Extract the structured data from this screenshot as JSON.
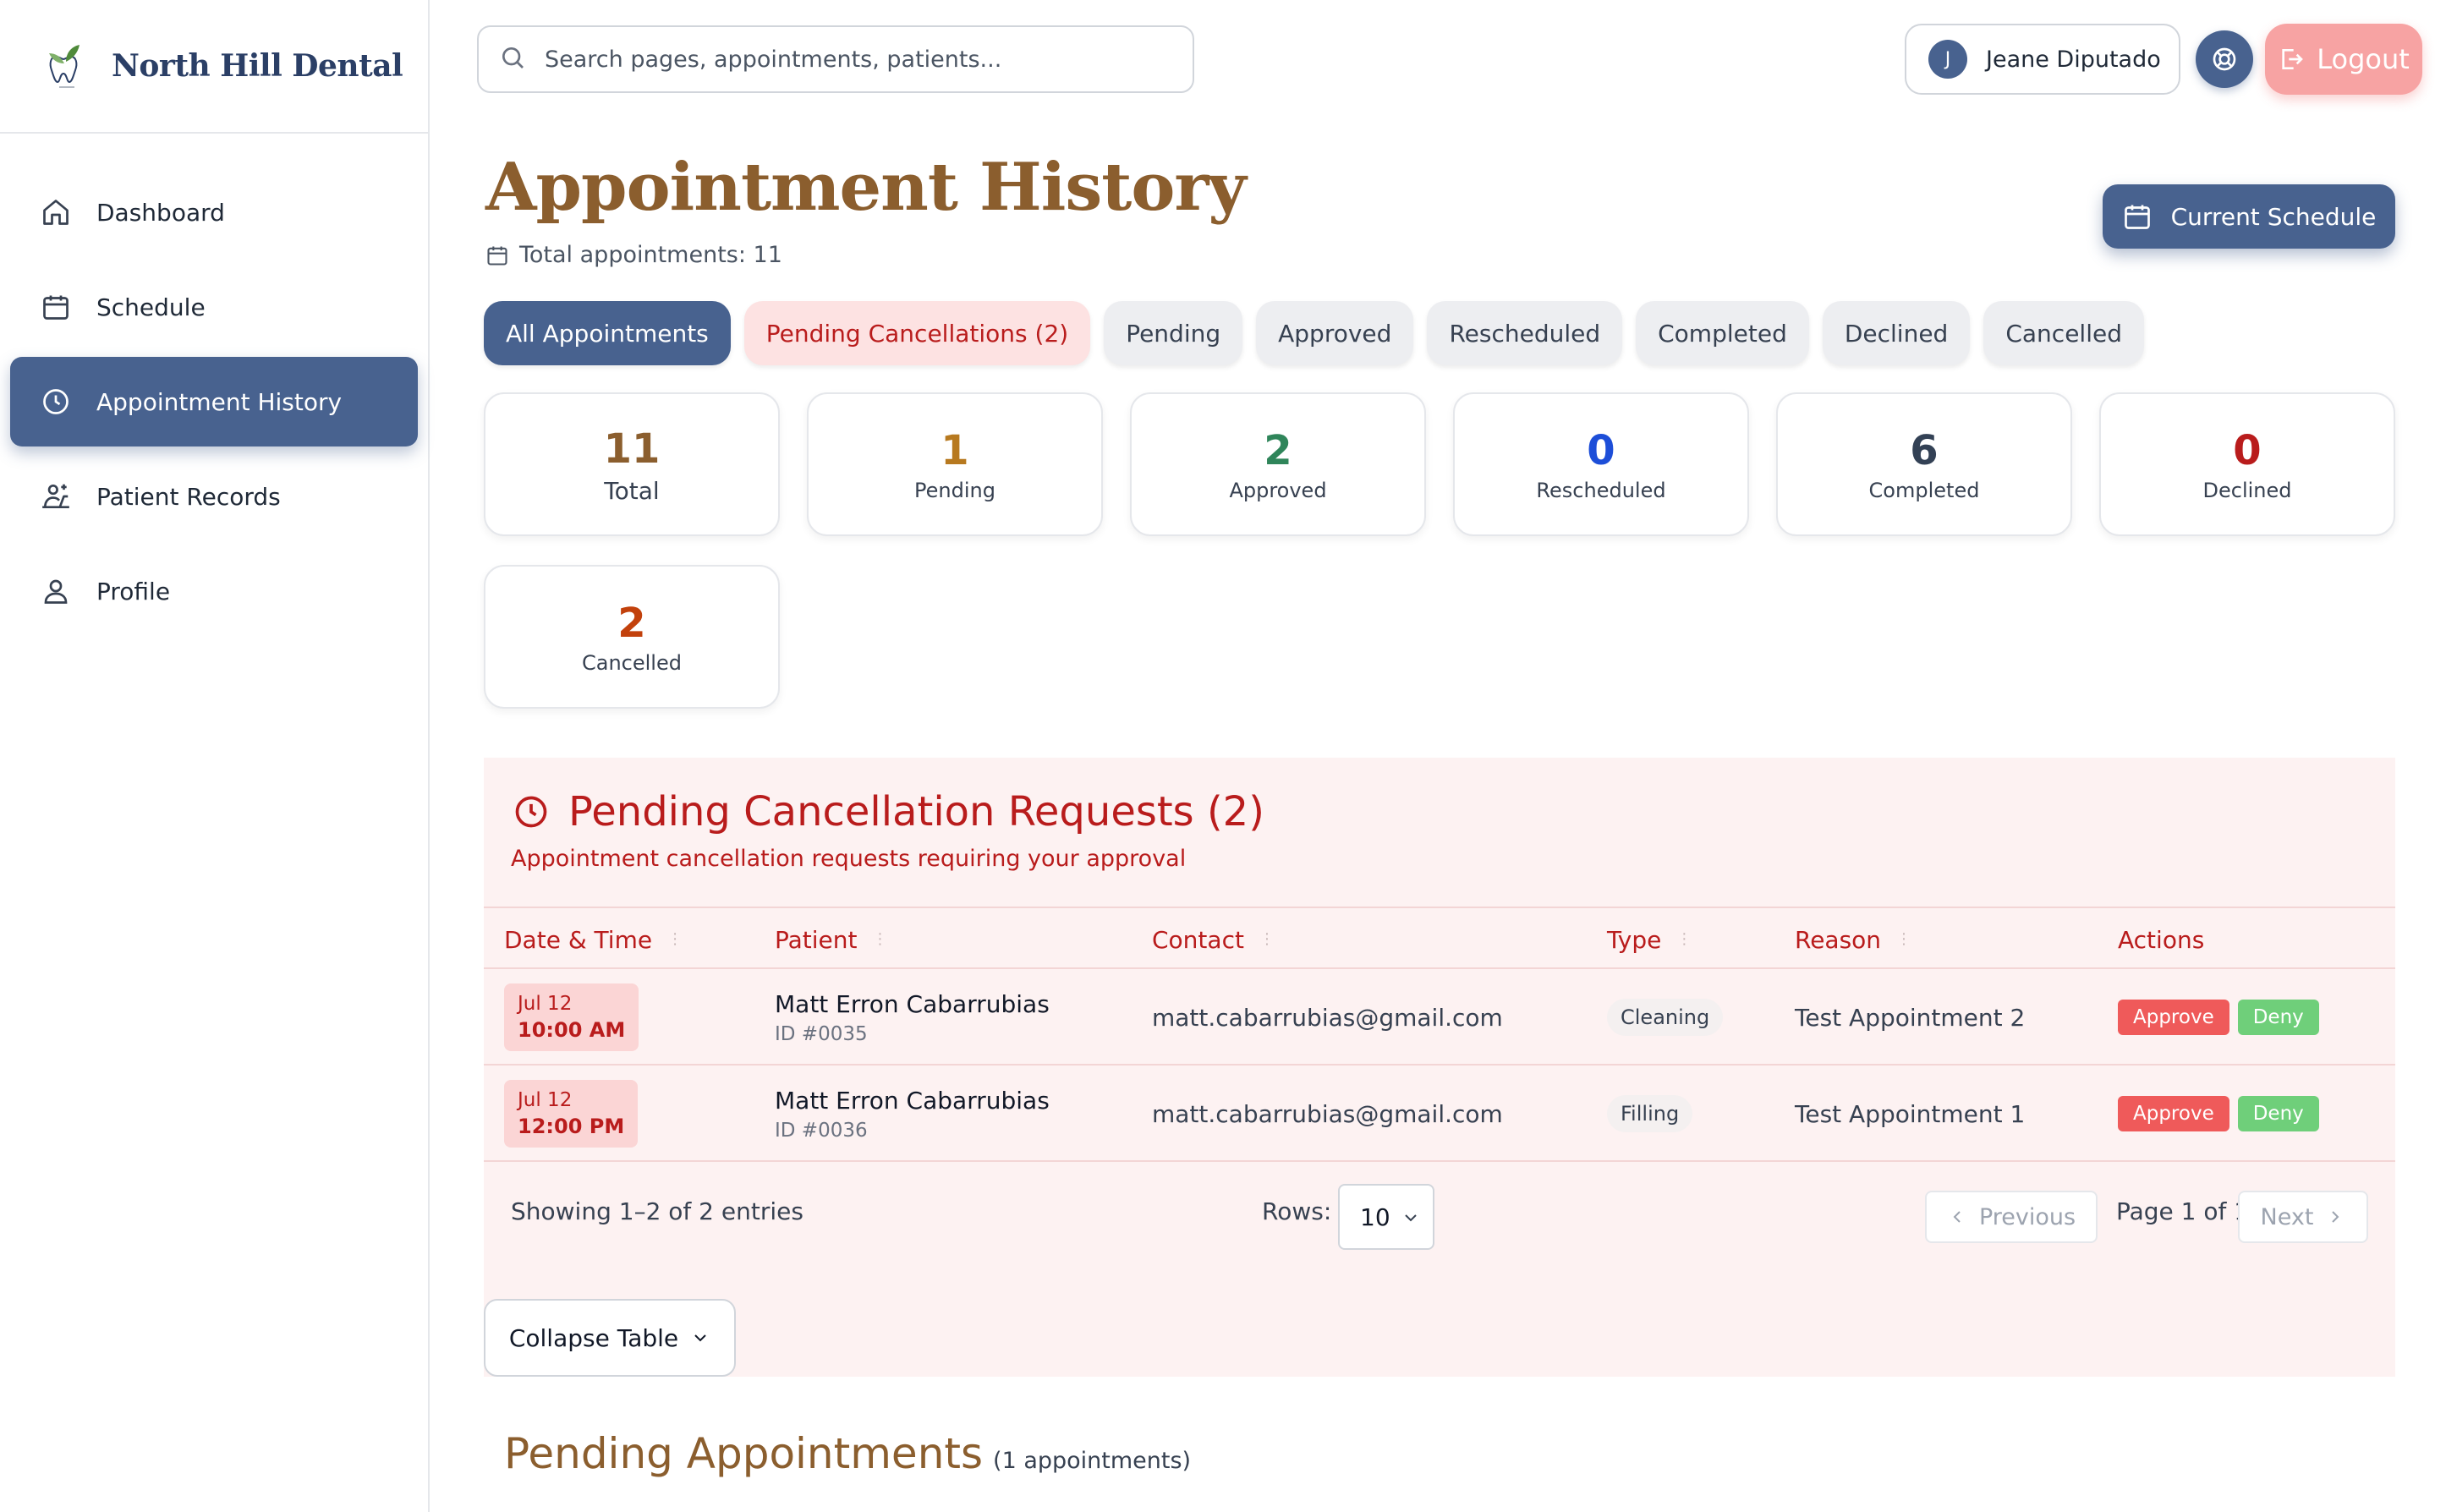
{
  "brand": {
    "name": "North Hill Dental",
    "logo_icon": "tooth-leaf-logo-icon"
  },
  "sidebar": {
    "items": [
      {
        "label": "Dashboard",
        "icon": "home-icon",
        "active": false
      },
      {
        "label": "Schedule",
        "icon": "calendar-icon",
        "active": false
      },
      {
        "label": "Appointment History",
        "icon": "clock-icon",
        "active": true
      },
      {
        "label": "Patient Records",
        "icon": "patient-records-icon",
        "active": false
      },
      {
        "label": "Profile",
        "icon": "user-icon",
        "active": false
      }
    ]
  },
  "topbar": {
    "search_placeholder": "Search pages, appointments, patients...",
    "user_initial": "J",
    "user_name": "Jeane Diputado",
    "logout_label": "Logout"
  },
  "header": {
    "title": "Appointment History",
    "total_text": "Total appointments: 11",
    "current_schedule_label": "Current Schedule"
  },
  "tabs": [
    {
      "label": "All Appointments",
      "state": "active"
    },
    {
      "label": "Pending Cancellations (2)",
      "state": "alert"
    },
    {
      "label": "Pending",
      "state": "normal"
    },
    {
      "label": "Approved",
      "state": "normal"
    },
    {
      "label": "Rescheduled",
      "state": "normal"
    },
    {
      "label": "Completed",
      "state": "normal"
    },
    {
      "label": "Declined",
      "state": "normal"
    },
    {
      "label": "Cancelled",
      "state": "normal"
    }
  ],
  "stats": [
    {
      "value": "11",
      "label": "Total",
      "color": "#8b5e2e"
    },
    {
      "value": "1",
      "label": "Pending",
      "color": "#b7791f"
    },
    {
      "value": "2",
      "label": "Approved",
      "color": "#2f855a"
    },
    {
      "value": "0",
      "label": "Rescheduled",
      "color": "#1d4ed8"
    },
    {
      "value": "6",
      "label": "Completed",
      "color": "#334155"
    },
    {
      "value": "0",
      "label": "Declined",
      "color": "#b91c1c"
    },
    {
      "value": "2",
      "label": "Cancelled",
      "color": "#c2410c"
    }
  ],
  "cancellations": {
    "title": "Pending Cancellation Requests (2)",
    "subtitle": "Appointment cancellation requests requiring your approval",
    "columns": [
      "Date & Time",
      "Patient",
      "Contact",
      "Type",
      "Reason",
      "Actions"
    ],
    "rows": [
      {
        "date": "Jul 12",
        "time": "10:00 AM",
        "patient": "Matt Erron Cabarrubias",
        "patient_id": "ID #0035",
        "contact": "matt.cabarrubias@gmail.com",
        "type": "Cleaning",
        "reason": "Test Appointment 2",
        "approve": "Approve",
        "deny": "Deny"
      },
      {
        "date": "Jul 12",
        "time": "12:00 PM",
        "patient": "Matt Erron Cabarrubias",
        "patient_id": "ID #0036",
        "contact": "matt.cabarrubias@gmail.com",
        "type": "Filling",
        "reason": "Test Appointment 1",
        "approve": "Approve",
        "deny": "Deny"
      }
    ],
    "showing": "Showing 1–2 of 2 entries",
    "rows_label": "Rows:",
    "rows_value": "10",
    "previous_label": "Previous",
    "page_info": "Page 1 of 1",
    "next_label": "Next",
    "collapse_label": "Collapse Table"
  },
  "pending_section": {
    "title": "Pending Appointments",
    "count_text": "(1 appointments)"
  },
  "colors": {
    "accent": "#48628f",
    "title_brown": "#8b5e2e",
    "alert_red": "#b91c1c",
    "approve": "#ef5a5a",
    "deny": "#6fcf7a"
  }
}
